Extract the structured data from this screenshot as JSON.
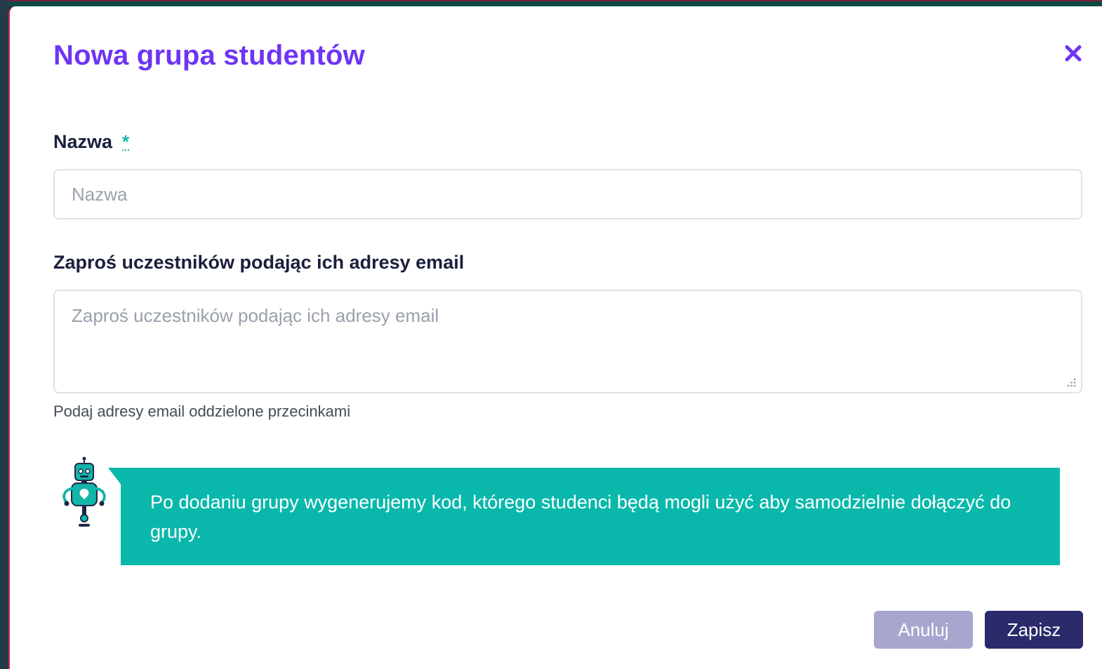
{
  "modal": {
    "title": "Nowa grupa studentów",
    "close_icon": "close-icon"
  },
  "form": {
    "name_label": "Nazwa",
    "required_marker": "*",
    "name_placeholder": "Nazwa",
    "name_value": "",
    "emails_label": "Zaproś uczestników podając ich adresy email",
    "emails_placeholder": "Zaproś uczestników podając ich adresy email",
    "emails_value": "",
    "emails_hint": "Podaj adresy email oddzielone przecinkami"
  },
  "info": {
    "icon": "robot-icon",
    "message": "Po dodaniu grupy wygenerujemy kod, którego studenci będą mogli użyć aby samodzielnie dołączyć do grupy."
  },
  "actions": {
    "cancel_label": "Anuluj",
    "save_label": "Zapisz"
  },
  "colors": {
    "title": "#6e34f4",
    "accent_teal": "#0ab8ab",
    "cancel_button": "#a7a6cf",
    "save_button": "#2b2a6b"
  }
}
